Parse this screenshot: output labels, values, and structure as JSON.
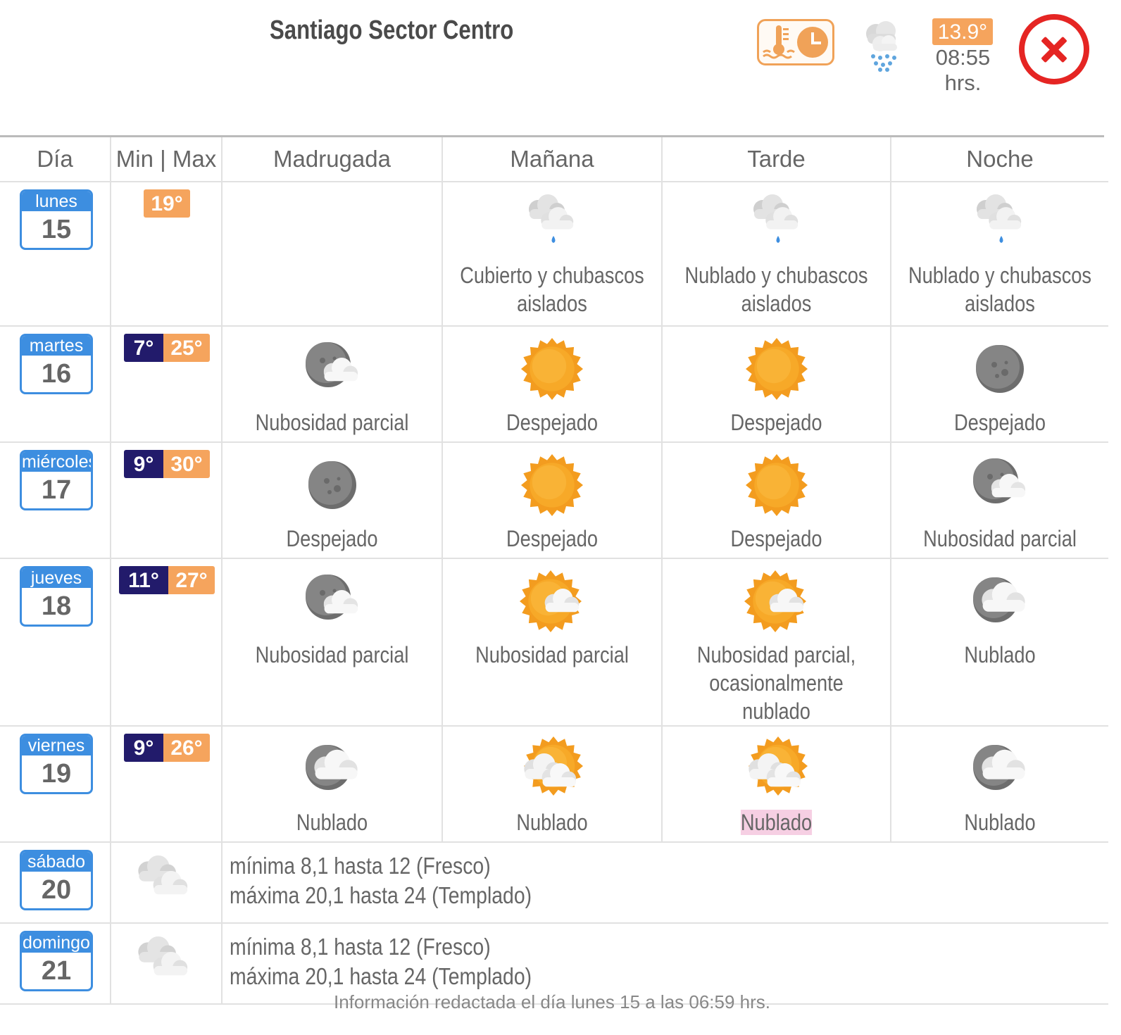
{
  "header": {
    "title": "Santiago Sector Centro",
    "current_temp": "13.9°",
    "current_time": "08:55 hrs.",
    "history_icon": "thermometer-clock-icon",
    "current_weather_icon": "cloud-rain-icon",
    "close_icon": "close-icon"
  },
  "columns": [
    "Día",
    "Min | Max",
    "Madrugada",
    "Mañana",
    "Tarde",
    "Noche"
  ],
  "days": [
    {
      "day": "lunes",
      "num": "15",
      "min": "",
      "max": "19°",
      "periods": [
        {
          "icon": "",
          "text": ""
        },
        {
          "icon": "cloud-showers-icon",
          "text": "Cubierto y chubascos aislados"
        },
        {
          "icon": "cloud-showers-icon",
          "text": "Nublado y chubascos aislados"
        },
        {
          "icon": "cloud-showers-icon",
          "text": "Nublado y chubascos aislados"
        }
      ]
    },
    {
      "day": "martes",
      "num": "16",
      "min": "7°",
      "max": "25°",
      "periods": [
        {
          "icon": "moon-cloud-icon",
          "text": "Nubosidad parcial"
        },
        {
          "icon": "sun-icon",
          "text": "Despejado"
        },
        {
          "icon": "sun-icon",
          "text": "Despejado"
        },
        {
          "icon": "moon-icon",
          "text": "Despejado"
        }
      ]
    },
    {
      "day": "miércoles",
      "num": "17",
      "min": "9°",
      "max": "30°",
      "periods": [
        {
          "icon": "moon-icon",
          "text": "Despejado"
        },
        {
          "icon": "sun-icon",
          "text": "Despejado"
        },
        {
          "icon": "sun-icon",
          "text": "Despejado"
        },
        {
          "icon": "moon-cloud-icon",
          "text": "Nubosidad parcial"
        }
      ]
    },
    {
      "day": "jueves",
      "num": "18",
      "min": "11°",
      "max": "27°",
      "periods": [
        {
          "icon": "moon-cloud-icon",
          "text": "Nubosidad parcial"
        },
        {
          "icon": "sun-cloud-icon",
          "text": "Nubosidad parcial"
        },
        {
          "icon": "sun-cloud-icon",
          "text": "Nubosidad parcial, ocasionalmente nublado"
        },
        {
          "icon": "moon-cloudy-icon",
          "text": "Nublado"
        }
      ]
    },
    {
      "day": "viernes",
      "num": "19",
      "min": "9°",
      "max": "26°",
      "periods": [
        {
          "icon": "moon-cloudy-icon",
          "text": "Nublado"
        },
        {
          "icon": "sun-cloudy-icon",
          "text": "Nublado"
        },
        {
          "icon": "sun-cloudy-icon",
          "text": "Nublado"
        },
        {
          "icon": "moon-cloudy-icon",
          "text": "Nublado"
        }
      ]
    },
    {
      "day": "sábado",
      "num": "20",
      "icon": "cloudy-icon",
      "summary": [
        "mínima 8,1 hasta 12 (Fresco)",
        "máxima 20,1 hasta 24 (Templado)"
      ]
    },
    {
      "day": "domingo",
      "num": "21",
      "icon": "cloudy-icon",
      "summary": [
        "mínima 8,1 hasta 12 (Fresco)",
        "máxima 20,1 hasta 24 (Templado)"
      ]
    }
  ],
  "footer": "Información redactada el día lunes 15 a las 06:59 hrs.",
  "colors": {
    "calendar_blue": "#3d8ee0",
    "min_temp": "#221b6b",
    "max_temp": "#f5a45d",
    "close_red": "#e52523",
    "highlight": "#f6cfe3"
  }
}
